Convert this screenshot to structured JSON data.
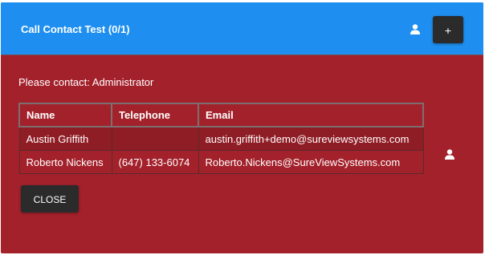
{
  "dialog": {
    "title": "Call Contact Test (0/1)",
    "add_label": "+",
    "prompt": "Please contact: Administrator",
    "close_label": "CLOSE"
  },
  "table": {
    "headers": [
      "Name",
      "Telephone",
      "Email"
    ],
    "rows": [
      {
        "name": "Austin Griffith",
        "telephone": "",
        "email": "austin.griffith+demo@sureviewsystems.com"
      },
      {
        "name": "Roberto Nickens",
        "telephone": "(647) 133-6074",
        "email": "Roberto.Nickens@SureViewSystems.com"
      }
    ]
  },
  "icons": {
    "header_user": "user-icon",
    "row_user": "user-icon"
  },
  "colors": {
    "header_bg": "#1e8ff0",
    "dialog_bg": "#a3212b",
    "button_bg": "#2b2b2b"
  }
}
